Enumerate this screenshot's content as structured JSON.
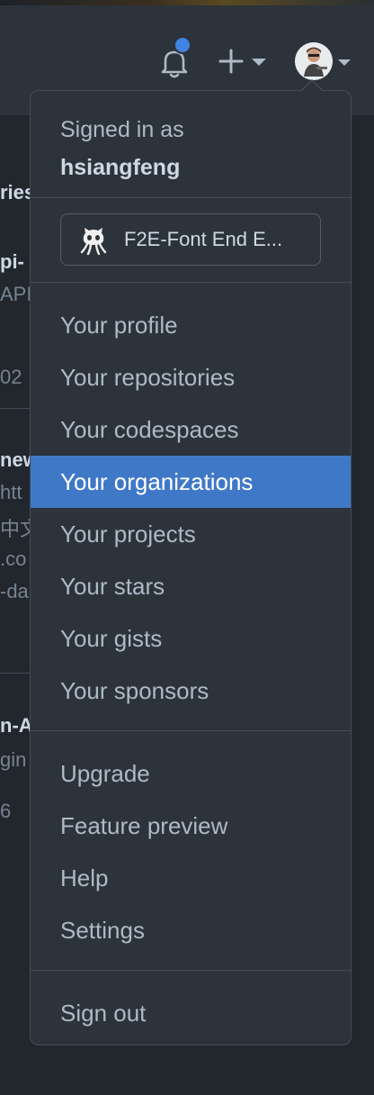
{
  "header": {
    "notifications_icon": "bell-icon",
    "create_icon": "plus-icon",
    "avatar_icon": "avatar-icon"
  },
  "background": {
    "fragments": [
      "ries",
      "pi-",
      "API",
      "02",
      "new",
      "htt",
      "中文",
      ".co",
      "-da",
      "n-A",
      "gin",
      "6"
    ]
  },
  "menu": {
    "signed_in_label": "Signed in as",
    "username": "hsiangfeng",
    "status_label": "F2E-Font End E...",
    "primary_items": [
      "Your profile",
      "Your repositories",
      "Your codespaces",
      "Your organizations",
      "Your projects",
      "Your stars",
      "Your gists",
      "Your sponsors"
    ],
    "secondary_items": [
      "Upgrade",
      "Feature preview",
      "Help",
      "Settings"
    ],
    "sign_out_label": "Sign out",
    "active_item": "Your organizations"
  },
  "colors": {
    "background": "#22272e",
    "menu_bg": "#2d333b",
    "highlight": "#4078c8",
    "notification_dot": "#4184e4"
  }
}
